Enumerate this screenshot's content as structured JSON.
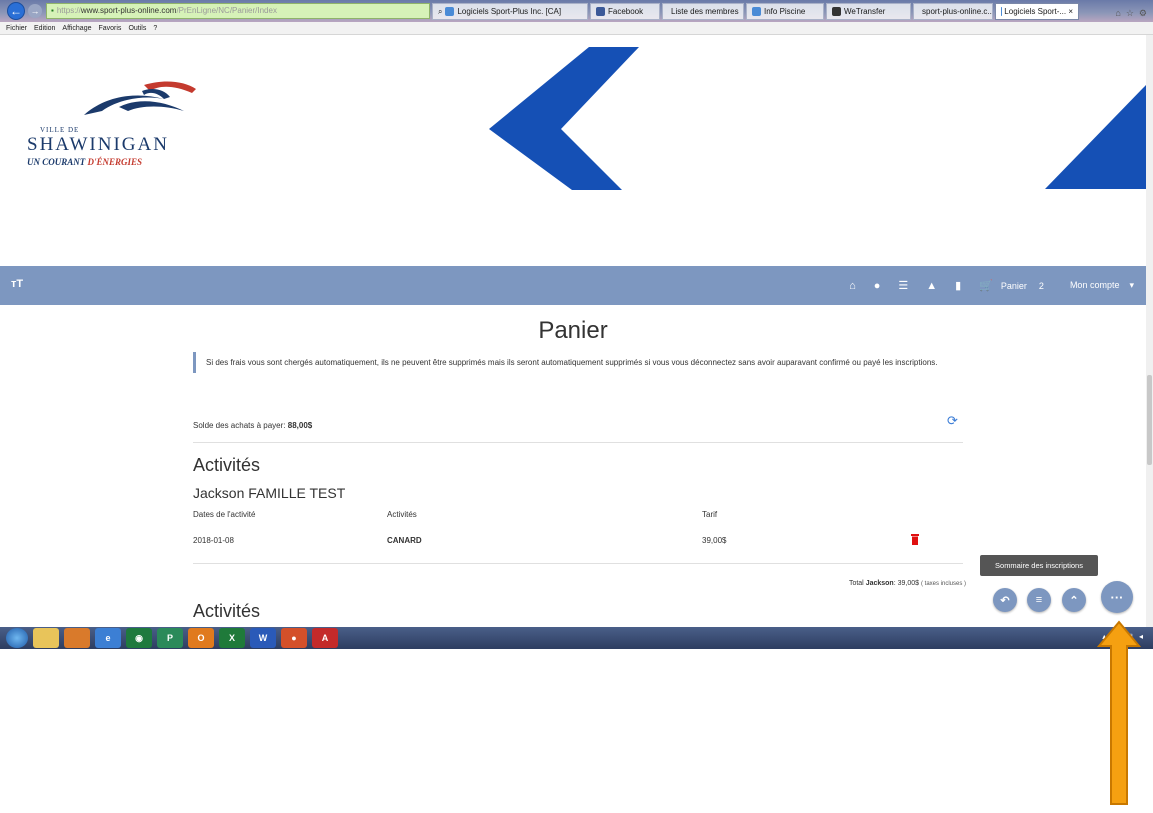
{
  "browser": {
    "back_label": "←",
    "forward_label": "→",
    "url_prefix": "https://",
    "url_host": "www.sport-plus-online.com",
    "url_path": "/PrEnLigne/NC/Panier/Index",
    "tabs": [
      {
        "label": "Logiciels Sport-Plus Inc. [CA]",
        "extra": "ρ ▾ 🔒 ... C"
      },
      {
        "label": "Facebook"
      },
      {
        "label": "Liste des membres"
      },
      {
        "label": "Info Piscine"
      },
      {
        "label": "WeTransfer"
      },
      {
        "label": "sport-plus-online.c..."
      },
      {
        "label": "Logiciels Sport-... ×"
      }
    ]
  },
  "menu": [
    "Fichier",
    "Edition",
    "Affichage",
    "Favoris",
    "Outils",
    "?"
  ],
  "logo": {
    "ville": "VILLE DE",
    "city": "SHAWINIGAN",
    "tagline_a": "UN COURANT ",
    "tagline_b": "D'ÉNERGIES"
  },
  "nav": {
    "text_size_label": "тT",
    "home_icon": "home-icon",
    "cart_label": "Panier",
    "cart_count": "2",
    "account_label": "Mon compte",
    "account_caret": "▾"
  },
  "cart": {
    "title": "Panier",
    "notice": "Si des frais vous sont chergés automatiquement, ils ne peuvent être supprimés mais ils seront automatiquement supprimés si vous vous déconnectez sans avoir auparavant confirmé ou payé les inscriptions.",
    "balance_label": "Solde des achats à payer:",
    "balance_value": "88,00$",
    "section_title": "Activités",
    "person_name": "Jackson FAMILLE TEST",
    "columns": [
      "Dates de l'activité",
      "Activités",
      "Tarif"
    ],
    "rows": [
      {
        "date": "2018-01-08",
        "activity": "CANARD",
        "price": "39,00$"
      }
    ],
    "total_label": "Total",
    "total_name": "Jackson",
    "total_value": ": 39,00$",
    "total_note": "( taxes incluses )",
    "section_title_2": "Activités"
  },
  "floating": {
    "tooltip": "Sommaire des inscriptions",
    "btn_undo": "↶",
    "btn_list": "≡",
    "btn_up": "⌃",
    "btn_more": "···"
  },
  "colors": {
    "nav_bg": "#7d97c0",
    "brand_blue": "#1550b5",
    "arrow_fill": "#f5a011",
    "arrow_stroke": "#c87800",
    "trash": "#e01010"
  }
}
